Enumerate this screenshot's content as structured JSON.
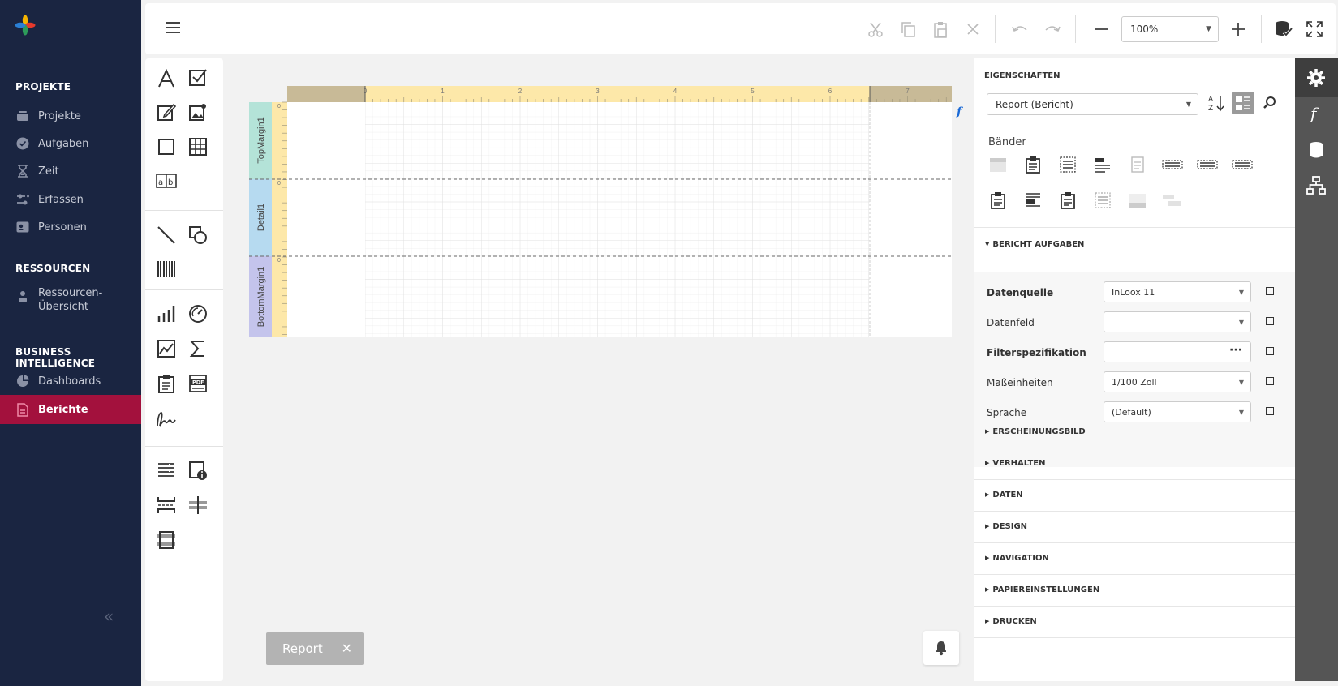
{
  "sidebar": {
    "sections": {
      "projekte": "PROJEKTE",
      "ressourcen": "RESSOURCEN",
      "bi": "BUSINESS INTELLIGENCE"
    },
    "items": {
      "projekte": "Projekte",
      "aufgaben": "Aufgaben",
      "zeit": "Zeit",
      "erfassen": "Erfassen",
      "personen": "Personen",
      "ressourcen_uebersicht": "Ressourcen-\nÜbersicht",
      "dashboards": "Dashboards",
      "berichte": "Berichte"
    },
    "active_item": "Berichte",
    "collapse_glyph": "«",
    "colors": {
      "background": "#1a2541",
      "active": "#a3113d"
    }
  },
  "toolbar": {
    "zoom_value": "100%",
    "icons": [
      "menu-icon",
      "cut-icon",
      "copy-icon",
      "paste-icon",
      "delete-icon",
      "undo-icon",
      "redo-icon",
      "zoom-out-icon",
      "zoom-in-icon",
      "validate-icon",
      "fullscreen-icon"
    ]
  },
  "designer": {
    "bands": [
      "TopMargin1",
      "Detail1",
      "BottomMargin1"
    ],
    "ruler_ticks": [
      "0",
      "1",
      "2",
      "3",
      "4",
      "5",
      "6",
      "7"
    ],
    "ruler_vertical_ticks": [
      "0",
      "0",
      "0"
    ],
    "fx_glyph": "f"
  },
  "tab": {
    "label": "Report",
    "close": "✕"
  },
  "properties": {
    "header": "EIGENSCHAFTEN",
    "object_selector": "Report (Bericht)",
    "bands_label": "Bänder",
    "tasks_group": "BERICHT AUFGABEN",
    "fields": [
      {
        "label": "Datenquelle",
        "value": "InLoox 11",
        "bold": true
      },
      {
        "label": "Datenfeld",
        "value": "",
        "bold": false
      },
      {
        "label": "Filterspezifikation",
        "value": "",
        "bold": true
      },
      {
        "label": "Maßeinheiten",
        "value": "1/100 Zoll",
        "bold": false
      },
      {
        "label": "Sprache",
        "value": "(Default)",
        "bold": false
      }
    ],
    "ellipsis": "···",
    "groups": [
      "ERSCHEINUNGSBILD",
      "VERHALTEN",
      "DATEN",
      "DESIGN",
      "NAVIGATION",
      "PAPIEREINSTELLUNGEN",
      "DRUCKEN"
    ]
  },
  "right_panel": {
    "icons": [
      "settings-icon",
      "expression-icon",
      "data-source-icon",
      "report-explorer-icon"
    ]
  }
}
